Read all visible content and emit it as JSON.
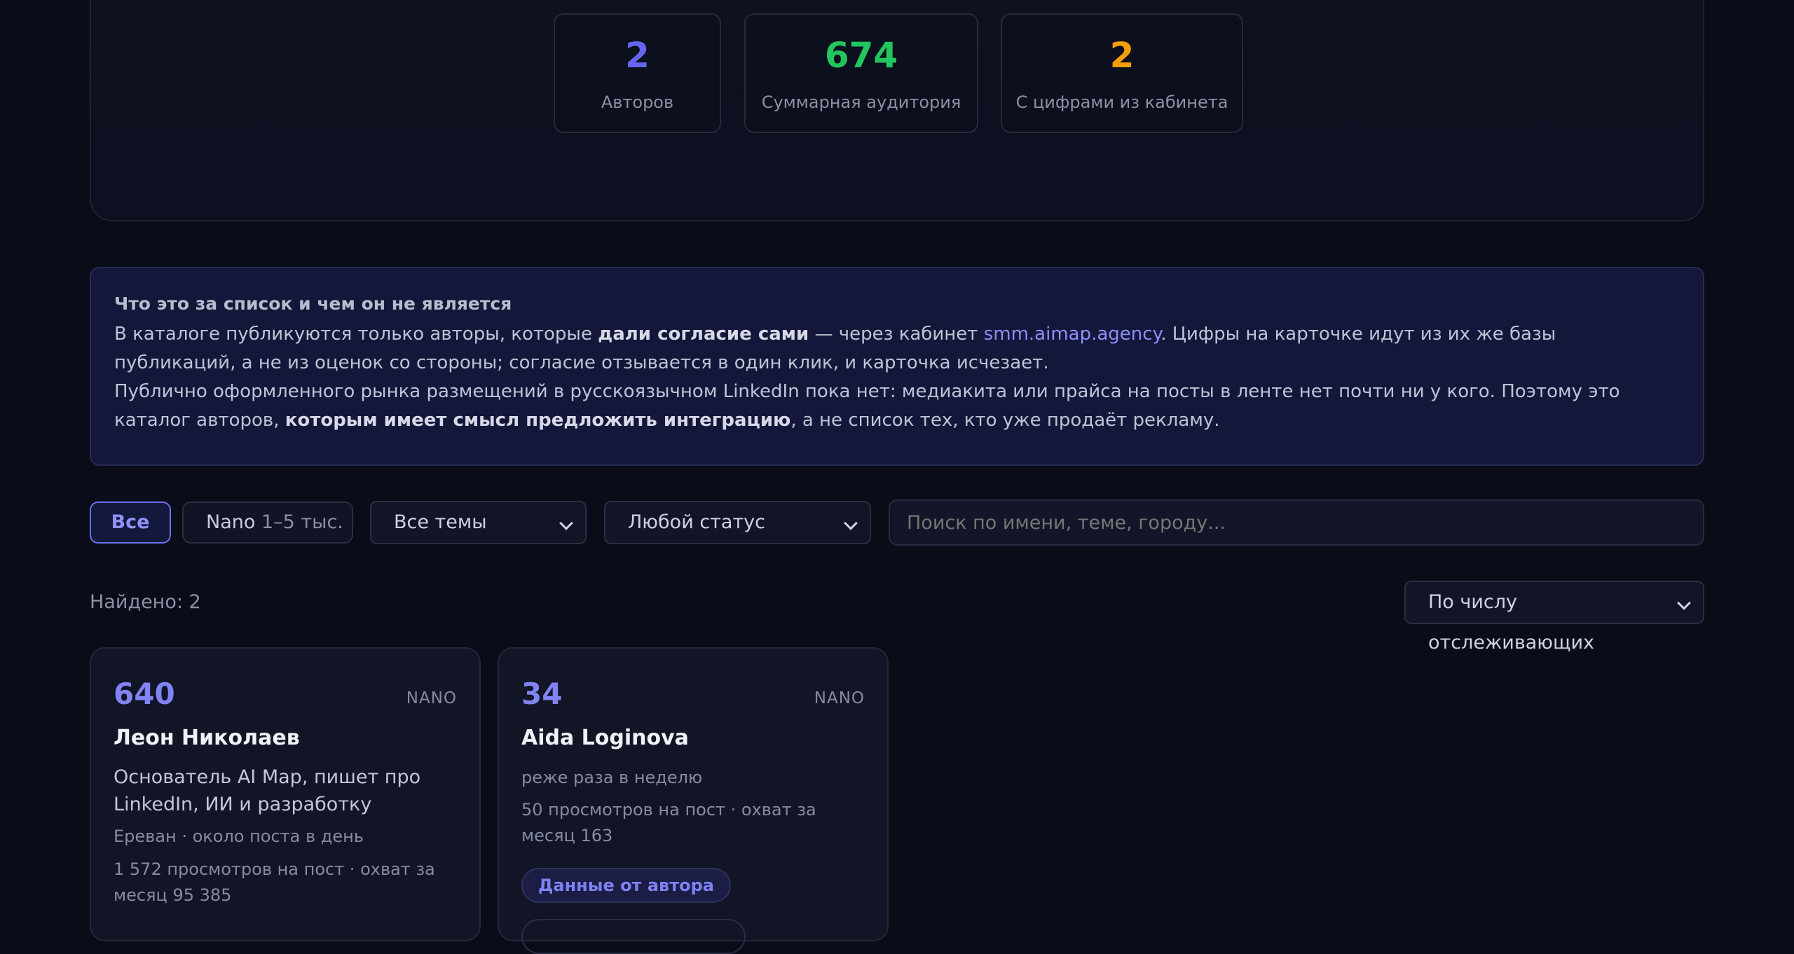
{
  "stats": [
    {
      "value": "2",
      "label": "Авторов",
      "color": "#6466f1"
    },
    {
      "value": "674",
      "label": "Суммарная аудитория",
      "color": "#22c55e"
    },
    {
      "value": "2",
      "label": "С цифрами из кабинета",
      "color": "#f59e0b"
    }
  ],
  "note": {
    "title": "Что это за список и чем он не является",
    "p1_a": "В каталоге публикуются только авторы, которые ",
    "p1_b": "дали согласие сами",
    "p1_c": " — через кабинет ",
    "p1_link": "smm.aimap.agency",
    "p1_d": ". Цифры на карточке идут из их же базы публикаций, а не из оценок со стороны; согласие отзывается в один клик, и карточка исчезает.",
    "p2_a": "Публично оформленного рынка размещений в русскоязычном LinkedIn пока нет: медиакита или прайса на посты в ленте нет почти ни у кого. Поэтому это каталог авторов, ",
    "p2_b": "которым имеет смысл предложить интеграцию",
    "p2_c": ", а не список тех, кто уже продаёт рекламу."
  },
  "filters": {
    "all_label": "Все",
    "nano_label": "Nano",
    "nano_range": "1–5 тыс.",
    "topics_selected": "Все темы",
    "status_selected": "Любой статус",
    "search_placeholder": "Поиск по имени, теме, городу..."
  },
  "results": {
    "found": "Найдено: 2",
    "sort_selected": "По числу отслеживающих"
  },
  "cards": [
    {
      "count": "640",
      "tier": "NANO",
      "name": "Леон Николаев",
      "desc": "Основатель AI Map, пишет про LinkedIn, ИИ и разработку",
      "meta1": "Ереван · около поста в день",
      "meta2": "1 572 просмотров на пост · охват за месяц 95 385"
    },
    {
      "count": "34",
      "tier": "NANO",
      "name": "Aida Loginova",
      "meta1": "реже раза в неделю",
      "meta2": "50 просмотров на пост · охват за месяц 163",
      "badge": "Данные от автора"
    }
  ]
}
